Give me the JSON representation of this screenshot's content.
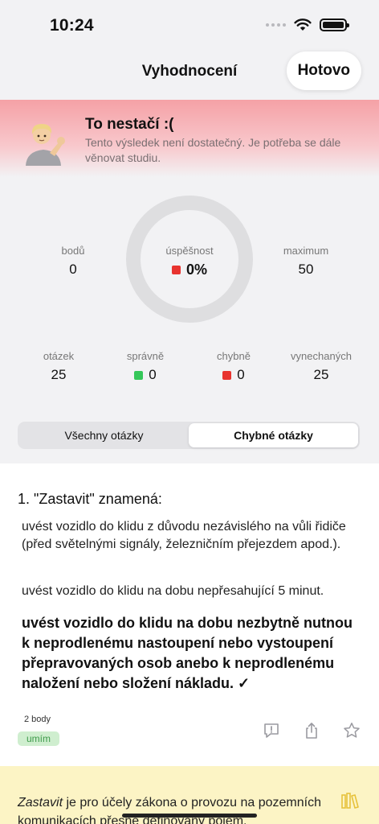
{
  "status_bar": {
    "time": "10:24"
  },
  "nav": {
    "title": "Vyhodnocení",
    "done_label": "Hotovo"
  },
  "result": {
    "title": "To nestačí :(",
    "description": "Tento výsledek není dostatečný. Je potřeba se dále věnovat studiu."
  },
  "stats": {
    "points_label": "bodů",
    "points_value": "0",
    "success_label": "úspěšnost",
    "success_value": "0%",
    "success_fraction": 0,
    "max_label": "maximum",
    "max_value": "50",
    "questions_label": "otázek",
    "questions_value": "25",
    "correct_label": "správně",
    "correct_value": "0",
    "wrong_label": "chybně",
    "wrong_value": "0",
    "skipped_label": "vynechaných",
    "skipped_value": "25"
  },
  "tabs": [
    {
      "label": "Všechny otázky",
      "active": false
    },
    {
      "label": "Chybné otázky",
      "active": true
    }
  ],
  "question": {
    "title": "1. \"Zastavit\" znamená:",
    "answers": [
      {
        "text": "uvést vozidlo do klidu z důvodu nezávislého na vůli řidiče (před světelnými signály, železničním přejezdem apod.).",
        "correct": false
      },
      {
        "text": "uvést vozidlo do klidu na dobu nepřesahující 5 minut.",
        "correct": false
      },
      {
        "text": "uvést vozidlo do klidu na dobu nezbytně nutnou k neprodlenému nastoupení nebo vystoupení přepravovaných osob anebo k neprodlenému naložení nebo složení nákladu. ✓",
        "correct": true
      }
    ],
    "points": "2 body",
    "badge": "umím"
  },
  "explanation": {
    "term": "Zastavit",
    "text": " je pro účely zákona o provozu na pozemních komunikacích přesně definovaný pojem."
  },
  "colors": {
    "wrong": "#e8332f",
    "correct": "#35c759",
    "banner": "#f5a1a6",
    "explanation_bg": "#fcf4c5"
  },
  "icons": [
    "wifi-icon",
    "battery-icon",
    "person-shrug-icon",
    "report-icon",
    "share-icon",
    "star-icon",
    "book-icon"
  ]
}
